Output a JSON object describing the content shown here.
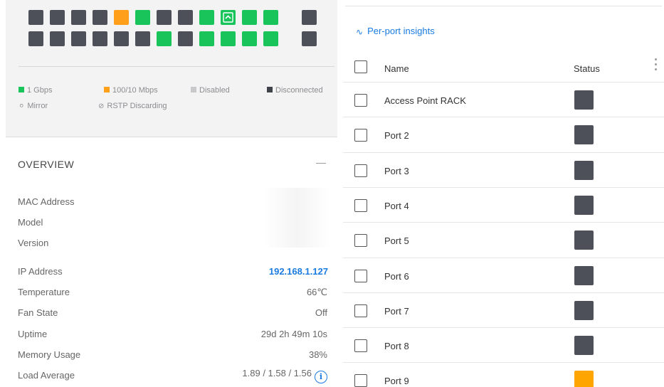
{
  "ports": {
    "top_row": [
      "dark",
      "dark",
      "dark",
      "dark",
      "orange",
      "green",
      "dark",
      "dark",
      "green",
      "green-uplink",
      "green",
      "green"
    ],
    "bottom_row": [
      "dark",
      "dark",
      "dark",
      "dark",
      "dark",
      "dark",
      "green",
      "dark",
      "green",
      "green",
      "green",
      "green"
    ],
    "sfp_top": "dark",
    "sfp_bottom": "dark",
    "colors": {
      "dark": "#4d5059",
      "green": "#19c45a",
      "orange": "#ff9f1a"
    }
  },
  "legend": {
    "gbps": "1 Gbps",
    "mbps": "100/10 Mbps",
    "disabled": "Disabled",
    "disconnected": "Disconnected",
    "mirror": "Mirror",
    "rstp": "RSTP Discarding"
  },
  "overview": {
    "title": "OVERVIEW",
    "mac_label": "MAC Address",
    "model_label": "Model",
    "version_label": "Version",
    "ip_label": "IP Address",
    "ip_value": "192.168.1.127",
    "temp_label": "Temperature",
    "temp_value": "66℃",
    "fan_label": "Fan State",
    "fan_value": "Off",
    "uptime_label": "Uptime",
    "uptime_value": "29d 2h 49m 10s",
    "memory_label": "Memory Usage",
    "memory_value": "38%",
    "load_label": "Load Average",
    "load_value": "1.89 / 1.58 / 1.56"
  },
  "insights": {
    "link_label": "Per-port insights",
    "col_name": "Name",
    "col_status": "Status",
    "rows": [
      {
        "name": "Access Point RACK",
        "status": "dark"
      },
      {
        "name": "Port 2",
        "status": "dark"
      },
      {
        "name": "Port 3",
        "status": "dark"
      },
      {
        "name": "Port 4",
        "status": "dark"
      },
      {
        "name": "Port 5",
        "status": "dark"
      },
      {
        "name": "Port 6",
        "status": "dark"
      },
      {
        "name": "Port 7",
        "status": "dark"
      },
      {
        "name": "Port 8",
        "status": "dark"
      },
      {
        "name": "Port 9",
        "status": "orange"
      }
    ]
  }
}
